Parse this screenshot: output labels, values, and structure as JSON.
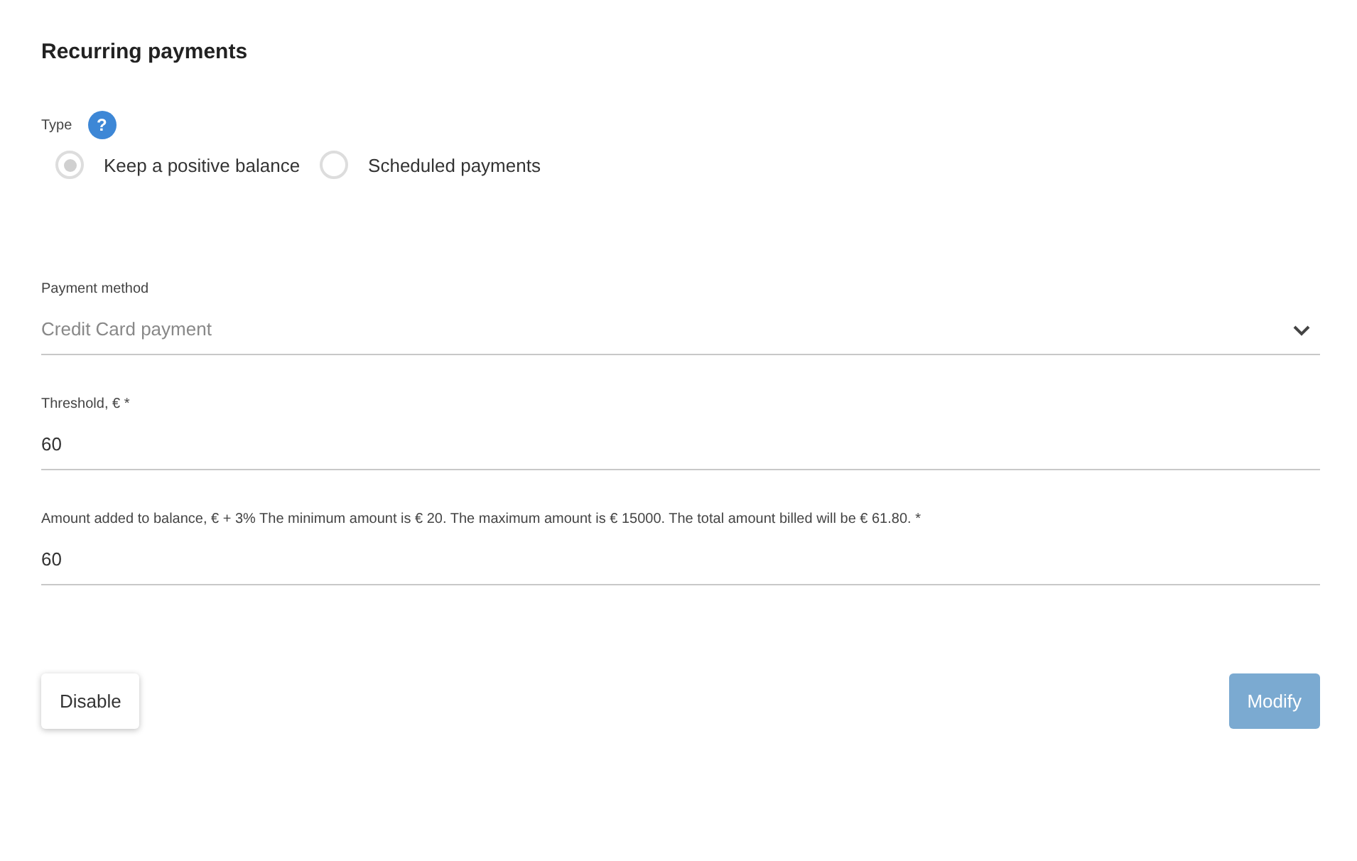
{
  "title": "Recurring payments",
  "type_field": {
    "label": "Type",
    "help": "?",
    "options": [
      {
        "label": "Keep a positive balance",
        "selected": true
      },
      {
        "label": "Scheduled payments",
        "selected": false
      }
    ]
  },
  "fields": [
    {
      "kind": "select",
      "label": "Payment method",
      "value": "Credit Card payment"
    },
    {
      "kind": "input",
      "label": "Threshold, € *",
      "value": "60"
    },
    {
      "kind": "input",
      "label": "Amount added to balance, € + 3% The minimum amount is € 20. The maximum amount is € 15000. The total amount billed will be € 61.80.  *",
      "value": "60"
    }
  ],
  "buttons": [
    {
      "label": "Disable",
      "disabled": false
    },
    {
      "label": "Modify",
      "disabled": true
    }
  ]
}
